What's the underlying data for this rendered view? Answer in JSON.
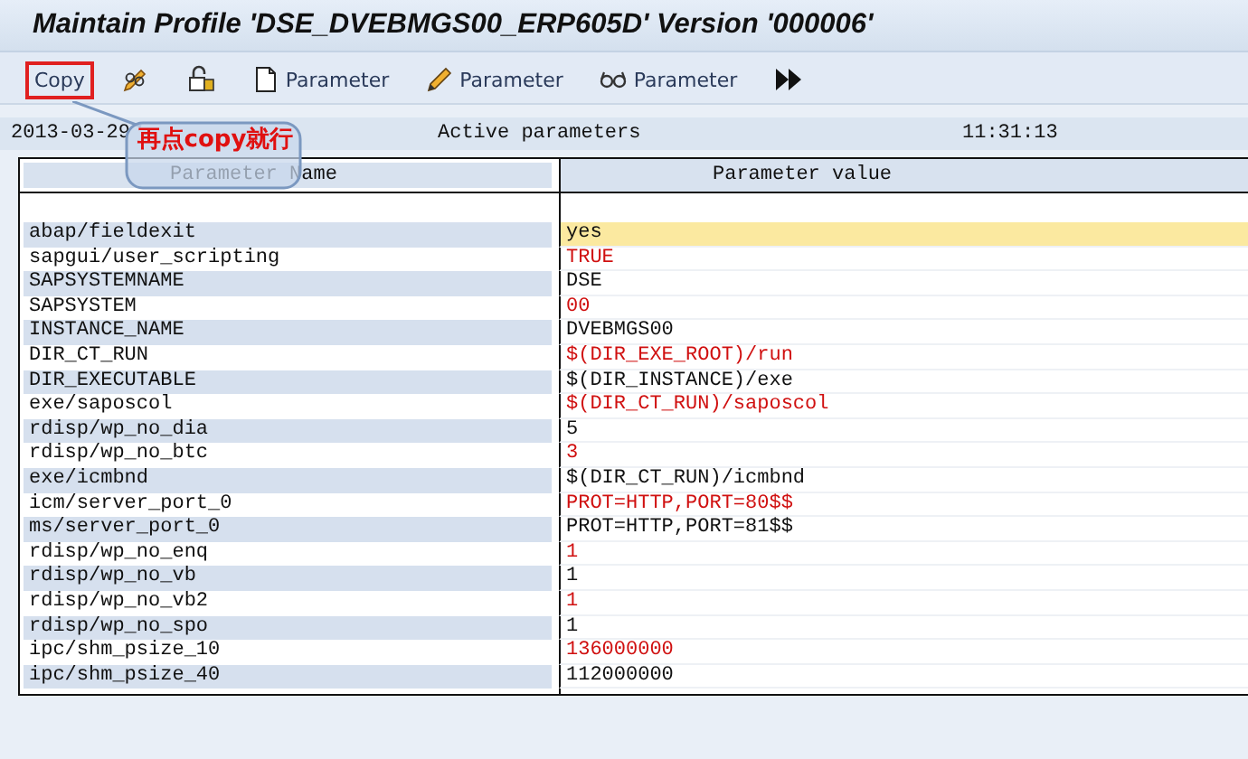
{
  "window": {
    "title": "Maintain Profile 'DSE_DVEBMGS00_ERP605D' Version '000006'"
  },
  "toolbar": [
    {
      "kind": "text",
      "label": "Copy",
      "highlighted": true
    },
    {
      "kind": "icon"
    },
    {
      "kind": "icon"
    },
    {
      "kind": "icon-text",
      "label": "Parameter"
    },
    {
      "kind": "icon-text",
      "label": "Parameter"
    },
    {
      "kind": "icon-text",
      "label": "Parameter"
    },
    {
      "kind": "icon"
    }
  ],
  "info_bar": {
    "date": "2013-03-29",
    "title": "Active parameters",
    "time": "11:31:13"
  },
  "callout": {
    "text": "再点copy就行"
  },
  "table": {
    "columns": [
      "Parameter Name",
      "Parameter value"
    ],
    "rows": [
      {
        "name": "abap/fieldexit",
        "value": "yes",
        "changed": false,
        "selected": true
      },
      {
        "name": "sapgui/user_scripting",
        "value": "TRUE",
        "changed": true,
        "selected": false
      },
      {
        "name": "SAPSYSTEMNAME",
        "value": "DSE",
        "changed": false,
        "selected": false
      },
      {
        "name": "SAPSYSTEM",
        "value": "00",
        "changed": true,
        "selected": false
      },
      {
        "name": "INSTANCE_NAME",
        "value": "DVEBMGS00",
        "changed": false,
        "selected": false
      },
      {
        "name": "DIR_CT_RUN",
        "value": "$(DIR_EXE_ROOT)/run",
        "changed": true,
        "selected": false
      },
      {
        "name": "DIR_EXECUTABLE",
        "value": "$(DIR_INSTANCE)/exe",
        "changed": false,
        "selected": false
      },
      {
        "name": "exe/saposcol",
        "value": "$(DIR_CT_RUN)/saposcol",
        "changed": true,
        "selected": false
      },
      {
        "name": "rdisp/wp_no_dia",
        "value": "5",
        "changed": false,
        "selected": false
      },
      {
        "name": "rdisp/wp_no_btc",
        "value": "3",
        "changed": true,
        "selected": false
      },
      {
        "name": "exe/icmbnd",
        "value": "$(DIR_CT_RUN)/icmbnd",
        "changed": false,
        "selected": false
      },
      {
        "name": "icm/server_port_0",
        "value": "PROT=HTTP,PORT=80$$",
        "changed": true,
        "selected": false
      },
      {
        "name": "ms/server_port_0",
        "value": "PROT=HTTP,PORT=81$$",
        "changed": false,
        "selected": false
      },
      {
        "name": "rdisp/wp_no_enq",
        "value": "1",
        "changed": true,
        "selected": false
      },
      {
        "name": "rdisp/wp_no_vb",
        "value": "1",
        "changed": false,
        "selected": false
      },
      {
        "name": "rdisp/wp_no_vb2",
        "value": "1",
        "changed": true,
        "selected": false
      },
      {
        "name": "rdisp/wp_no_spo",
        "value": "1",
        "changed": false,
        "selected": false
      },
      {
        "name": "ipc/shm_psize_10",
        "value": "136000000",
        "changed": true,
        "selected": false
      },
      {
        "name": "ipc/shm_psize_40",
        "value": "112000000",
        "changed": false,
        "selected": false
      }
    ]
  }
}
